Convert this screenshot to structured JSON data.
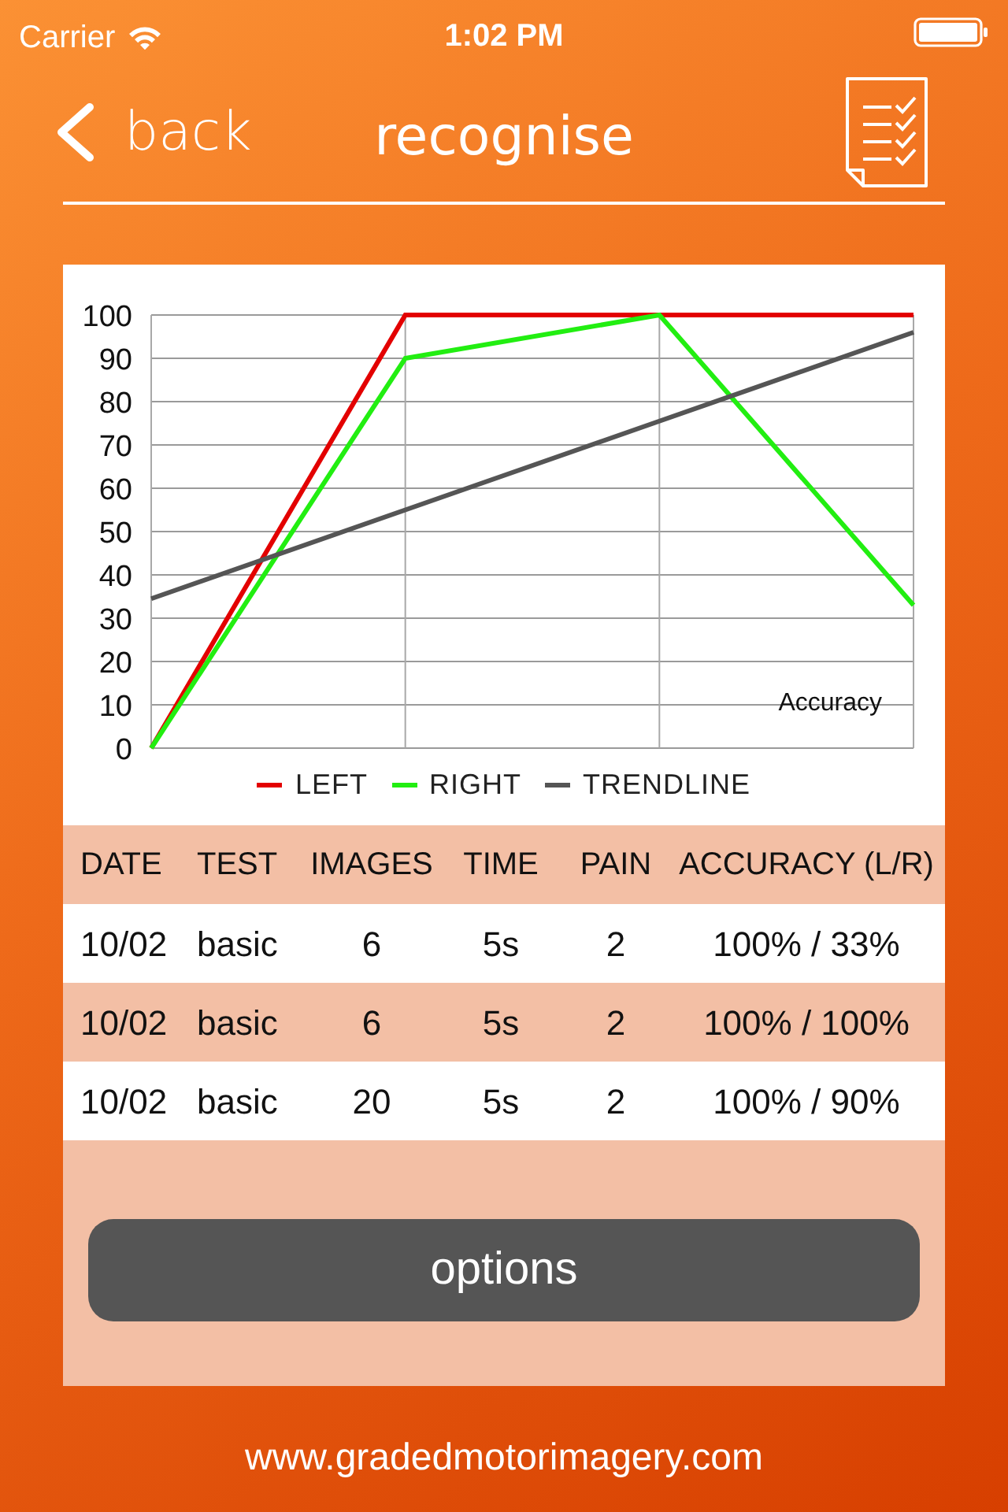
{
  "status_bar": {
    "carrier": "Carrier",
    "time": "1:02 PM"
  },
  "nav": {
    "back": "back",
    "title": "recognise"
  },
  "chart": {
    "chart_data": {
      "type": "line",
      "title": "Accuracy",
      "grid": true,
      "legend": true,
      "ylim": [
        0,
        100
      ],
      "yticks": [
        0,
        10,
        20,
        30,
        40,
        50,
        60,
        70,
        80,
        90,
        100
      ],
      "series": [
        {
          "name": "LEFT",
          "color": "#e30000",
          "values": [
            0,
            100,
            100,
            100
          ]
        },
        {
          "name": "RIGHT",
          "color": "#22ee11",
          "values": [
            0,
            90,
            100,
            33
          ]
        },
        {
          "name": "TRENDLINE",
          "color": "#555555",
          "values": [
            34.5,
            55,
            75.5,
            96
          ]
        }
      ]
    }
  },
  "table": {
    "columns": [
      "DATE",
      "TEST",
      "IMAGES",
      "TIME",
      "PAIN",
      "ACCURACY (L/R)"
    ],
    "rows": [
      [
        "10/02",
        "basic",
        "6",
        "5s",
        "2",
        "100% / 33%"
      ],
      [
        "10/02",
        "basic",
        "6",
        "5s",
        "2",
        "100% / 100%"
      ],
      [
        "10/02",
        "basic",
        "20",
        "5s",
        "2",
        "100% / 90%"
      ]
    ]
  },
  "options_button": "options",
  "footer": "www.gradedmotorimagery.com"
}
